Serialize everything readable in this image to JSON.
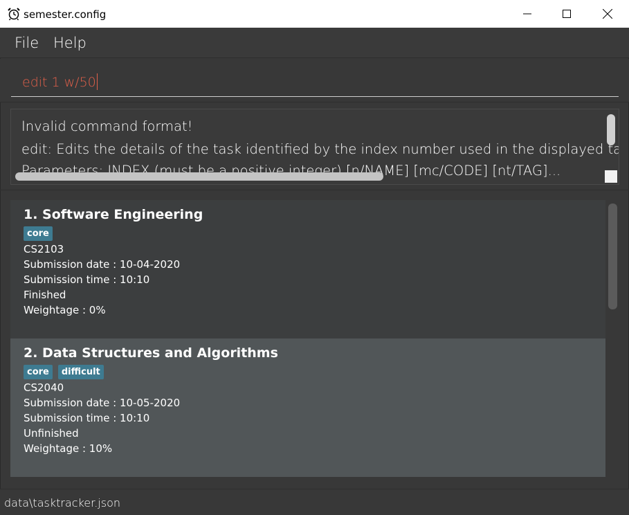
{
  "window": {
    "title": "semester.config",
    "app_icon": "alarm-clock-icon"
  },
  "menu": {
    "items": [
      {
        "label": "File"
      },
      {
        "label": "Help"
      }
    ]
  },
  "command_box": {
    "value": "edit 1 w/50"
  },
  "result_display": {
    "lines": [
      "Invalid command format!",
      "edit: Edits the details of the task identified by the index number used in the displayed task list.",
      "Parameters: INDEX (must be a positive integer) [n/NAME] [mc/CODE] [nt/TAG]..."
    ]
  },
  "tasks": [
    {
      "title": "1.  Software Engineering",
      "tags": [
        "core"
      ],
      "code": "CS2103",
      "date": "Submission date : 10-04-2020",
      "time": "Submission time : 10:10",
      "status": "Finished",
      "weightage": "Weightage : 0%"
    },
    {
      "title": "2.  Data Structures and Algorithms",
      "tags": [
        "core",
        "difficult"
      ],
      "code": "CS2040",
      "date": "Submission date : 10-05-2020",
      "time": "Submission time : 10:10",
      "status": "Unfinished",
      "weightage": "Weightage : 10%"
    }
  ],
  "status_bar": {
    "path": "data\\tasktracker.json"
  },
  "colors": {
    "command_text": "#e0604a",
    "tag_background": "#3e7b91",
    "selected_card": "#515658"
  }
}
